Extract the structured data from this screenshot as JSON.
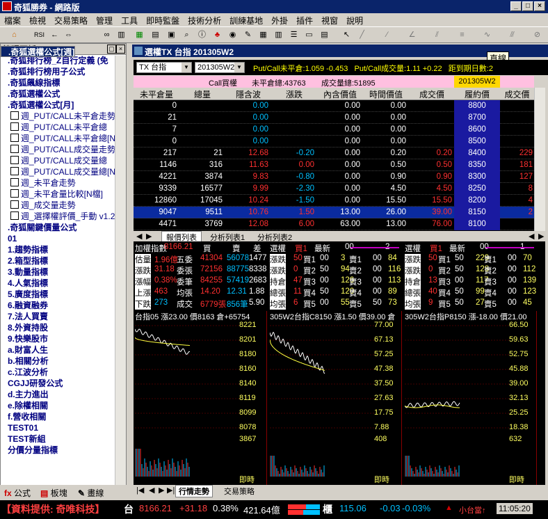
{
  "window": {
    "title": "奇狐勝券 - 網路版"
  },
  "menu": [
    "檔案",
    "檢視",
    "交易策略",
    "管理",
    "工具",
    "即時監盤",
    "技術分析",
    "訓練基地",
    "外掛",
    "插件",
    "視窗",
    "說明"
  ],
  "left_panel": {
    "title": "管理面板",
    "items": [
      {
        "label": ".奇狐排行榜_Z自行定義 (免",
        "type": "folder"
      },
      {
        "label": ".奇狐排行榜用子公式",
        "type": "folder"
      },
      {
        "label": ".奇狐飆線指標",
        "type": "folder"
      },
      {
        "label": ".奇狐選權公式",
        "type": "folder"
      },
      {
        "label": ".奇狐選權公式[月]",
        "type": "folder"
      },
      {
        "label": ".奇狐選權公式[週]",
        "type": "selected"
      },
      {
        "label": "週_PUT/CALL未平倉走勢",
        "type": "sub"
      },
      {
        "label": "週_PUT/CALL未平倉總",
        "type": "sub"
      },
      {
        "label": "週_PUT/CALL未平倉總[N",
        "type": "sub"
      },
      {
        "label": "週_PUT/CALL成交量走勢",
        "type": "sub"
      },
      {
        "label": "週_PUT/CALL成交量總",
        "type": "sub"
      },
      {
        "label": "週_PUT/CALL成交量總[N",
        "type": "sub"
      },
      {
        "label": "週_未平倉走勢",
        "type": "sub"
      },
      {
        "label": "週_未平倉量比較[N檔]",
        "type": "sub"
      },
      {
        "label": "週_成交量走勢",
        "type": "sub"
      },
      {
        "label": "週_選擇權評價_手動 v1.2",
        "type": "sub"
      },
      {
        "label": ".奇狐關鍵價量公式",
        "type": "folder"
      },
      {
        "label": "01",
        "type": "folder"
      },
      {
        "label": "1.趨勢指標",
        "type": "folder"
      },
      {
        "label": "2.箱型指標",
        "type": "folder"
      },
      {
        "label": "3.動量指標",
        "type": "folder"
      },
      {
        "label": "4.人氣指標",
        "type": "folder"
      },
      {
        "label": "5.廣度指標",
        "type": "folder"
      },
      {
        "label": "6.融資融券",
        "type": "folder"
      },
      {
        "label": "7.法人買賣",
        "type": "folder"
      },
      {
        "label": "8.外資持股",
        "type": "folder"
      },
      {
        "label": "9.快樂股市",
        "type": "folder"
      },
      {
        "label": "a.財富人生",
        "type": "folder"
      },
      {
        "label": "b.相關分析",
        "type": "folder"
      },
      {
        "label": "c.江波分析",
        "type": "folder"
      },
      {
        "label": "CGJJ研發公式",
        "type": "folder"
      },
      {
        "label": "d.主力進出",
        "type": "folder"
      },
      {
        "label": "e.除權相關",
        "type": "folder"
      },
      {
        "label": "f.營收相關",
        "type": "folder"
      },
      {
        "label": "TEST01",
        "type": "folder"
      },
      {
        "label": "TEST新組",
        "type": "folder"
      },
      {
        "label": "分價分量指標",
        "type": "folder"
      }
    ],
    "tabs": [
      "公式",
      "板塊",
      "畫線"
    ]
  },
  "option_window": {
    "title": "選權TX 台指 201305W2",
    "tooltip": "直線",
    "symbol": "TX 台指",
    "contract": "201305W2",
    "pc_oi": "Put/Call未平倉:1.059 -0.453",
    "pc_vol": "Put/Call成交量:1.11 +0.22",
    "days": "距到期日數:2",
    "call_label": "Call買權",
    "call_oi": "未平倉總:43763",
    "call_vol": "成交量總:51895",
    "contract_badge": "201305W2",
    "columns": [
      "未平倉量",
      "總量",
      "隱含波",
      "漲跌",
      "內含價值",
      "時間價值",
      "成交價",
      "履約價",
      "成交價"
    ],
    "rows": [
      {
        "oi": "0",
        "vol": "",
        "iv": "0.00",
        "chg": "",
        "intr": "0.00",
        "tv": "0.00",
        "px": "",
        "strike": "8800",
        "px2": "",
        "hl": false
      },
      {
        "oi": "21",
        "vol": "",
        "iv": "0.00",
        "chg": "",
        "intr": "0.00",
        "tv": "0.00",
        "px": "",
        "strike": "8700",
        "px2": "",
        "hl": false
      },
      {
        "oi": "7",
        "vol": "",
        "iv": "0.00",
        "chg": "",
        "intr": "0.00",
        "tv": "0.00",
        "px": "",
        "strike": "8600",
        "px2": "",
        "hl": false
      },
      {
        "oi": "0",
        "vol": "",
        "iv": "0.00",
        "chg": "",
        "intr": "0.00",
        "tv": "0.00",
        "px": "",
        "strike": "8500",
        "px2": "",
        "hl": false
      },
      {
        "oi": "217",
        "vol": "21",
        "iv": "12.68",
        "chg": "-0.20",
        "intr": "0.00",
        "tv": "0.20",
        "px": "0.20",
        "strike": "8400",
        "px2": "229",
        "hl": false
      },
      {
        "oi": "1146",
        "vol": "316",
        "iv": "11.63",
        "chg": "0.00",
        "intr": "0.00",
        "tv": "0.50",
        "px": "0.50",
        "strike": "8350",
        "px2": "181",
        "hl": false
      },
      {
        "oi": "4221",
        "vol": "3874",
        "iv": "9.83",
        "chg": "-0.80",
        "intr": "0.00",
        "tv": "0.90",
        "px": "0.90",
        "strike": "8300",
        "px2": "127",
        "hl": false
      },
      {
        "oi": "9339",
        "vol": "16577",
        "iv": "9.99",
        "chg": "-2.30",
        "intr": "0.00",
        "tv": "4.50",
        "px": "4.50",
        "strike": "8250",
        "px2": "8",
        "hl": false
      },
      {
        "oi": "12860",
        "vol": "17045",
        "iv": "10.24",
        "chg": "-1.50",
        "intr": "0.00",
        "tv": "15.50",
        "px": "15.50",
        "strike": "8200",
        "px2": "4",
        "hl": false
      },
      {
        "oi": "9047",
        "vol": "9511",
        "iv": "10.76",
        "chg": "1.50",
        "intr": "13.00",
        "tv": "26.00",
        "px": "39.00",
        "strike": "8150",
        "px2": "2",
        "hl": true
      },
      {
        "oi": "4471",
        "vol": "3769",
        "iv": "12.08",
        "chg": "6.00",
        "intr": "63.00",
        "tv": "13.00",
        "px": "76.00",
        "strike": "8100",
        "px2": "",
        "hl": false
      }
    ],
    "tabs": [
      "報價列表",
      "分析列表1",
      "分析列表2"
    ]
  },
  "quotes": [
    {
      "header": [
        "加權指數",
        "8166.21",
        "買",
        "賣",
        "差"
      ],
      "lines": [
        [
          "估量",
          "1.96億",
          "五委",
          "41304",
          "56078",
          "14774"
        ],
        [
          "漲跌",
          "31.18",
          "委張",
          "72156",
          "88775",
          "83381"
        ],
        [
          "漲幅",
          "0.38%",
          "委筆",
          "84255",
          "57419",
          "26836"
        ],
        [
          "上漲",
          "463",
          "均張",
          "14.20",
          "12.31",
          "1.88"
        ],
        [
          "下跌",
          "273",
          "成交",
          "6779張",
          "856筆",
          "5.90"
        ]
      ]
    },
    {
      "header": [
        "選權",
        "買1",
        "最新",
        "00",
        "2"
      ],
      "lines": [
        [
          "漲跌",
          "50",
          "買1",
          "00",
          "3",
          "賣1",
          "00",
          "84"
        ],
        [
          "漲跌",
          "0",
          "買2",
          "50",
          "94",
          "賣2",
          "00",
          "116"
        ],
        [
          "持倉",
          "47",
          "買3",
          "00",
          "126",
          "賣3",
          "00",
          "113"
        ],
        [
          "總張",
          "11",
          "買4",
          "50",
          "120",
          "賣4",
          "00",
          "89"
        ],
        [
          "均張",
          "6",
          "買5",
          "00",
          "55",
          "賣5",
          "50",
          "73"
        ]
      ]
    },
    {
      "header": [
        "選權",
        "買1",
        "最新",
        "00",
        "1"
      ],
      "lines": [
        [
          "漲跌",
          "50",
          "買1",
          "50",
          "229",
          "賣1",
          "00",
          "70"
        ],
        [
          "漲跌",
          "0",
          "買2",
          "50",
          "128",
          "賣2",
          "00",
          "112"
        ],
        [
          "持倉",
          "13",
          "買3",
          "00",
          "117",
          "賣3",
          "00",
          "139"
        ],
        [
          "總張",
          "40",
          "買4",
          "50",
          "99",
          "賣4",
          "00",
          "123"
        ],
        [
          "均張",
          "9",
          "買5",
          "50",
          "27",
          "賣5",
          "00",
          "45"
        ]
      ]
    }
  ],
  "charts": [
    {
      "title": "台指05 漲23.00 價8163 倉+65754",
      "ticks": [
        "8221",
        "8201",
        "8180",
        "8160",
        "8140",
        "8119",
        "8099",
        "8078"
      ],
      "vol": "3867",
      "time": "即時"
    },
    {
      "title": "305W2台指C8150 漲1.50 價39.00 倉",
      "ticks": [
        "77.00",
        "67.13",
        "57.25",
        "47.38",
        "37.50",
        "27.63",
        "17.75",
        "7.88"
      ],
      "vol": "408",
      "time": "即時"
    },
    {
      "title": "305W2台指P8150 漲-18.00 價21.00",
      "ticks": [
        "66.50",
        "59.63",
        "52.75",
        "45.88",
        "39.00",
        "32.13",
        "25.25",
        "18.38"
      ],
      "vol": "632",
      "time": "即時"
    }
  ],
  "bottom_tabs": [
    "行情走勢",
    "交易策略"
  ],
  "statusbar": {
    "provider": "【資料提供: 奇唯科技】",
    "index_name": "台",
    "index": "8166.21",
    "chg": "+31.18",
    "pct": "0.38%",
    "amount": "421.64億",
    "cabinet": "櫃",
    "otc": "115.06",
    "otc_chg": "-0.03",
    "otc_pct": "-0.03%",
    "small": "小台當↑",
    "time": "11:05:20"
  }
}
